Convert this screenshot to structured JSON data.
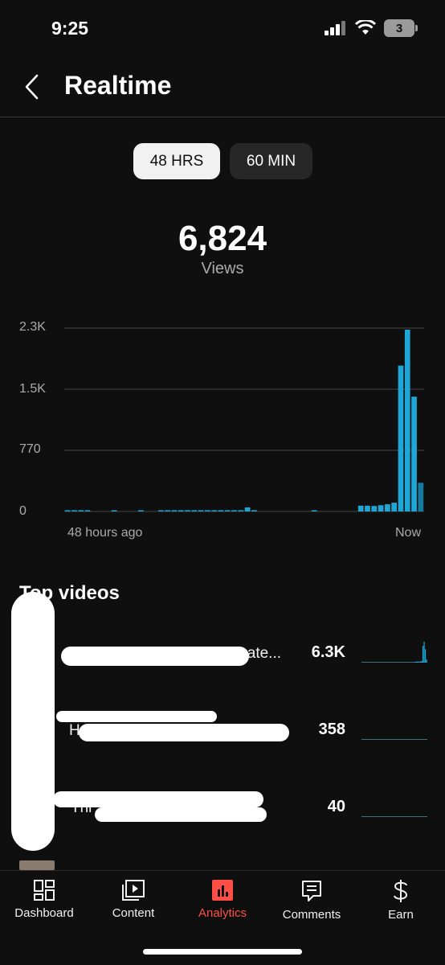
{
  "status_bar": {
    "time": "9:25",
    "battery": "3"
  },
  "header": {
    "title": "Realtime"
  },
  "toggle": {
    "option_48": "48 HRS",
    "option_60": "60 MIN",
    "selected": "48 HRS"
  },
  "summary": {
    "total_views": "6,824",
    "views_label": "Views"
  },
  "chart_data": {
    "type": "bar",
    "ylim": [
      0,
      2300
    ],
    "y_ticks": [
      "2.3K",
      "1.5K",
      "770",
      "0"
    ],
    "x_start_label": "48 hours ago",
    "x_end_label": "Now",
    "color": "#1ea7d6",
    "values": [
      12,
      12,
      8,
      10,
      0,
      0,
      0,
      5,
      0,
      0,
      0,
      6,
      0,
      0,
      10,
      10,
      10,
      10,
      10,
      10,
      10,
      10,
      10,
      10,
      12,
      14,
      15,
      50,
      16,
      0,
      0,
      0,
      0,
      0,
      0,
      0,
      0,
      5,
      0,
      0,
      0,
      0,
      0,
      0,
      72,
      72,
      68,
      78,
      90,
      110,
      1830,
      2280,
      1440,
      360
    ]
  },
  "top_videos": {
    "title": "Top videos",
    "items": [
      {
        "title": "ate...",
        "views": "6.3K",
        "spark": [
          0,
          0,
          0,
          0,
          0,
          0,
          0,
          0,
          0,
          0,
          0,
          0,
          0,
          0,
          0,
          0,
          0,
          0,
          0,
          0,
          0,
          0,
          0,
          0,
          0,
          0,
          0,
          0,
          0,
          0,
          0,
          0,
          0,
          0,
          0,
          0,
          0,
          0,
          0,
          0,
          0,
          0,
          0,
          0,
          5,
          5,
          5,
          5,
          6,
          8,
          80,
          100,
          65,
          15
        ]
      },
      {
        "title": "H",
        "views": "358",
        "spark": [
          1,
          1,
          1,
          1,
          1,
          1,
          1,
          1,
          1,
          1,
          1,
          1,
          1,
          1,
          1,
          1,
          1,
          1,
          1,
          1,
          1,
          1,
          1,
          1,
          1,
          1,
          1,
          1,
          1,
          1,
          1,
          1,
          1,
          1,
          1,
          1,
          1,
          1,
          1,
          1,
          1,
          1,
          1,
          1,
          1,
          1,
          1,
          1,
          1,
          1,
          1,
          1,
          1,
          1
        ]
      },
      {
        "title": "Thi",
        "views": "40",
        "spark": [
          1,
          1,
          1,
          1,
          1,
          1,
          1,
          1,
          1,
          1,
          1,
          1,
          1,
          1,
          1,
          1,
          1,
          1,
          1,
          1,
          1,
          1,
          1,
          1,
          1,
          1,
          1,
          1,
          1,
          1,
          1,
          1,
          1,
          1,
          1,
          1,
          1,
          1,
          1,
          1,
          1,
          1,
          1,
          1,
          1,
          1,
          1,
          1,
          1,
          1,
          1,
          1,
          1,
          1
        ]
      }
    ]
  },
  "bottom_nav": {
    "items": [
      {
        "label": "Dashboard",
        "icon": "dashboard-icon"
      },
      {
        "label": "Content",
        "icon": "content-icon"
      },
      {
        "label": "Analytics",
        "icon": "analytics-icon",
        "active": true
      },
      {
        "label": "Comments",
        "icon": "comments-icon"
      },
      {
        "label": "Earn",
        "icon": "dollar-icon"
      }
    ]
  }
}
